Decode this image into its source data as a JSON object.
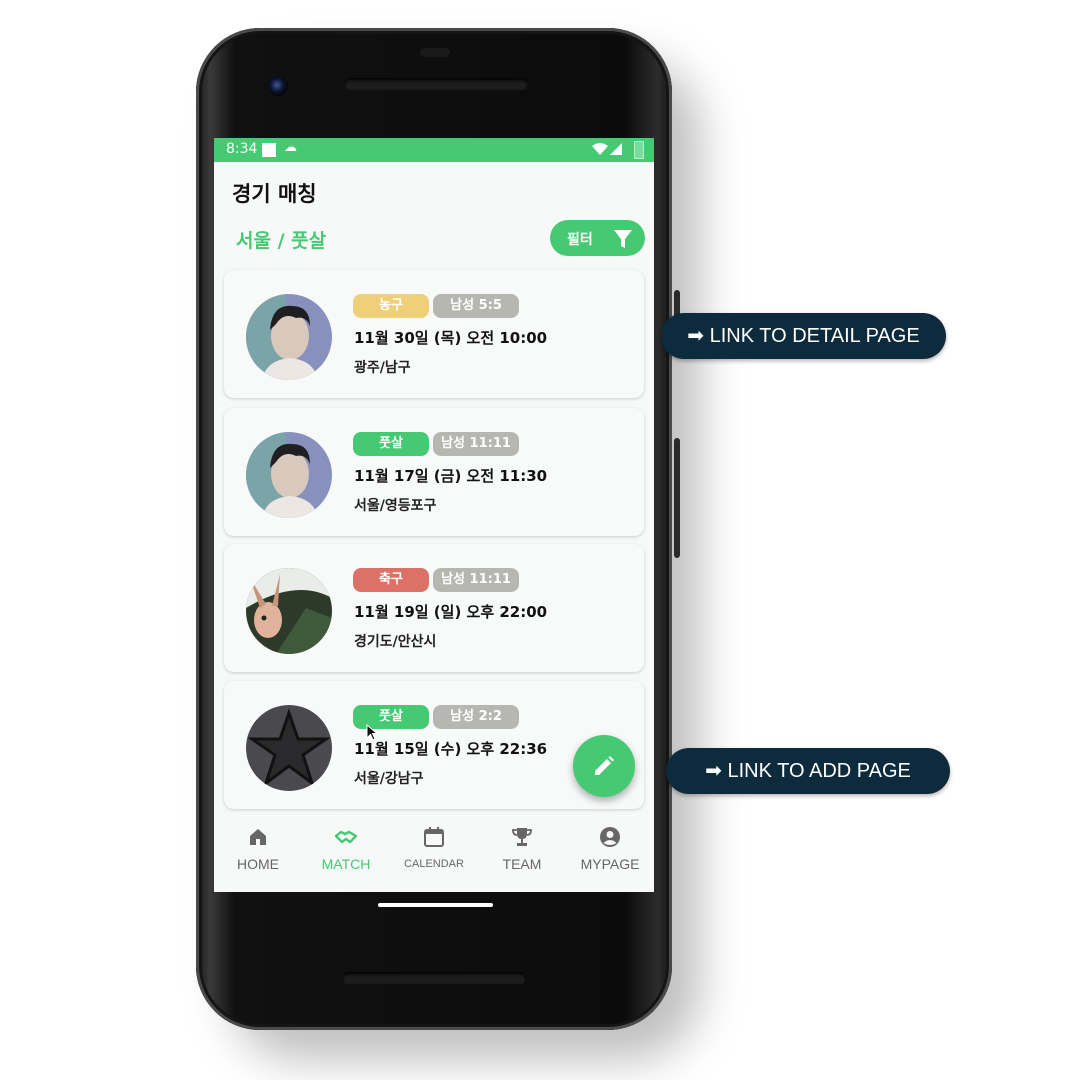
{
  "status_bar": {
    "time": "8:34"
  },
  "header": {
    "title": "경기 매칭"
  },
  "location": {
    "label": "서울 / 풋살"
  },
  "filter": {
    "label": "필터"
  },
  "colors": {
    "primary": "#45c972",
    "basketball": "#f0cf7b",
    "futsal": "#45c972",
    "soccer": "#dc7168",
    "gender_badge": "#b7b7b2",
    "callout": "#0e2b3e"
  },
  "matches": [
    {
      "sport": "농구",
      "sport_color": "#f0cf7b",
      "gender": "남성 5:5",
      "datetime": "11월 30일 (목) 오전 10:00",
      "place": "광주/남구",
      "avatar": "person-avatar"
    },
    {
      "sport": "풋살",
      "sport_color": "#45c972",
      "gender": "남성 11:11",
      "datetime": "11월 17일 (금) 오전 11:30",
      "place": "서울/영등포구",
      "avatar": "person-avatar"
    },
    {
      "sport": "축구",
      "sport_color": "#dc7168",
      "gender": "남성 11:11",
      "datetime": "11월 19일 (일) 오후 22:00",
      "place": "경기도/안산시",
      "avatar": "rabbit-avatar"
    },
    {
      "sport": "풋살",
      "sport_color": "#45c972",
      "gender": "남성 2:2",
      "datetime": "11월 15일 (수) 오후 22:36",
      "place": "서울/강남구",
      "avatar": "star-avatar"
    }
  ],
  "fab": {
    "icon": "pencil-icon"
  },
  "nav": [
    {
      "label": "HOME",
      "icon": "home-icon",
      "active": false
    },
    {
      "label": "MATCH",
      "icon": "handshake-icon",
      "active": true
    },
    {
      "label": "CALENDAR",
      "icon": "calendar-icon",
      "active": false
    },
    {
      "label": "TEAM",
      "icon": "trophy-icon",
      "active": false
    },
    {
      "label": "MYPAGE",
      "icon": "account-icon",
      "active": false
    }
  ],
  "callouts": {
    "detail": "➡ LINK TO DETAIL PAGE",
    "add": "➡ LINK TO ADD PAGE"
  }
}
